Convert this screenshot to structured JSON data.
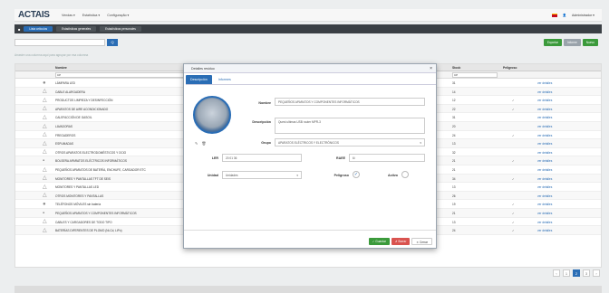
{
  "navbar": {
    "logo": "ACTAIS",
    "menu": [
      "Vendas ▾",
      "Estatística ▾",
      "Configuração ▾"
    ],
    "user": "Administrador ▾"
  },
  "tabs": [
    "Lista artículos",
    "Estadísticas generales",
    "Estadísticas personales"
  ],
  "toolbar": {
    "search_btn": "Q",
    "actions": [
      "Exportar",
      "Informe",
      "Nuevo"
    ]
  },
  "hint": "Arrastre una columna aquí para agrupar por esa columna",
  "grid": {
    "headers": [
      "Nombre",
      "Stock",
      "Peligroso"
    ],
    "filter": "CP",
    "filter_stock": "CP",
    "link_label": "ver detalles",
    "rows": [
      {
        "icon": "●",
        "name": "LÁMPARA LED",
        "g": "",
        "s": "",
        "stock": "31",
        "check": false
      },
      {
        "icon": "△",
        "name": "CABLE ALARGADERA",
        "g": "",
        "s": "",
        "stock": "14",
        "check": false
      },
      {
        "icon": "△",
        "name": "PRODUCTOS LIMPIEZA Y DESINFECCIÓN",
        "g": "",
        "s": "",
        "stock": "12",
        "check": true
      },
      {
        "icon": "△",
        "name": "APARATOS DE AIRE ACONDICIONADO",
        "g": "",
        "s": "",
        "stock": "22",
        "check": true
      },
      {
        "icon": "△",
        "name": "CALEFACCIÓN DE GASOIL",
        "g": "",
        "s": "",
        "stock": "31",
        "check": false
      },
      {
        "icon": "△",
        "name": "LAVADORAS",
        "g": "",
        "s": "",
        "stock": "20",
        "check": false
      },
      {
        "icon": "△",
        "name": "FREGADEROS",
        "g": "",
        "s": "",
        "stock": "24",
        "check": true
      },
      {
        "icon": "△",
        "name": "ESPUMADAS",
        "g": "",
        "s": "",
        "stock": "13",
        "check": false
      },
      {
        "icon": "△",
        "name": "OTROS APARATOS ELECTRODOMÉSTICOS Y OCIO",
        "g": "",
        "s": "",
        "stock": "32",
        "check": false
      },
      {
        "icon": "▪",
        "name": "BOLSERA APARATOS ELÉCTRICOS INFORMÁTICOS",
        "g": "",
        "s": "",
        "stock": "21",
        "check": true
      },
      {
        "icon": "△",
        "name": "PEQUEÑOS APARATOS DE BATERÍA, ENCHUFE, CARGADOR ETC",
        "g": "",
        "s": "",
        "stock": "21",
        "check": false
      },
      {
        "icon": "△",
        "name": "MONITORES Y PANTALLAS TFT DE SEIS",
        "g": "",
        "s": "",
        "stock": "34",
        "check": true
      },
      {
        "icon": "△",
        "name": "MONITORES Y PANTALLAS LED",
        "g": "",
        "s": "",
        "stock": "13",
        "check": false
      },
      {
        "icon": "△",
        "name": "OTROS MONITORES Y PANTALLAS",
        "g": "",
        "s": "",
        "stock": "26",
        "check": false
      },
      {
        "icon": "●",
        "name": "TELÉFONOS MÓVILES sin batería",
        "g": "",
        "s": "",
        "stock": "19",
        "check": true
      },
      {
        "icon": "▪",
        "name": "PEQUEÑOS APARATOS Y COMPONENTES INFORMÁTICOS",
        "g": "",
        "s": "",
        "stock": "21",
        "check": true
      },
      {
        "icon": "△",
        "name": "CABLES Y CARGADORES DE TODO TIPO",
        "g": "APARATOS ELÉCTRICOS Y ELECTRÓNICOS",
        "s": "20.02.36",
        "stock": "13",
        "check": true
      },
      {
        "icon": "△",
        "name": "BATERÍAS DIFERENTES DE PLOMO (Ni-Cd, LiPo)",
        "g": "APARATOS ELÉCTRICOS Y ELECTRÓNICOS",
        "s": "20.01.33",
        "stock": "24",
        "check": true
      }
    ]
  },
  "pager": [
    "‹",
    "1",
    "2",
    "3",
    "›"
  ],
  "modal": {
    "title": "Detalles residuo",
    "close": "×",
    "tabs": [
      "Descripción",
      "Informes"
    ],
    "photo_tools": [
      "✎",
      "🗑"
    ],
    "labels": {
      "name": "Nombre",
      "description": "Descripción",
      "group": "Grupo",
      "ler": "LER",
      "raee": "RAEE",
      "unit": "Unidad",
      "dangerous": "Peligroso",
      "active": "Activo"
    },
    "values": {
      "name": "PEQUEÑOS APARATOS Y COMPONENTES INFORMÁTICOS",
      "description": "Quest ultimas USB router MPR-3",
      "group": "APARATOS ELÉCTRICOS Y ELECTRÓNICOS",
      "ler": "20 01 36",
      "raee": "6i",
      "unit": "Unidades",
      "dangerous_mark": "✓",
      "active_mark": ""
    },
    "buttons": {
      "save": "✓ Guardar",
      "delete": "✗ Borrar",
      "close": "✕ Cerrar"
    }
  }
}
